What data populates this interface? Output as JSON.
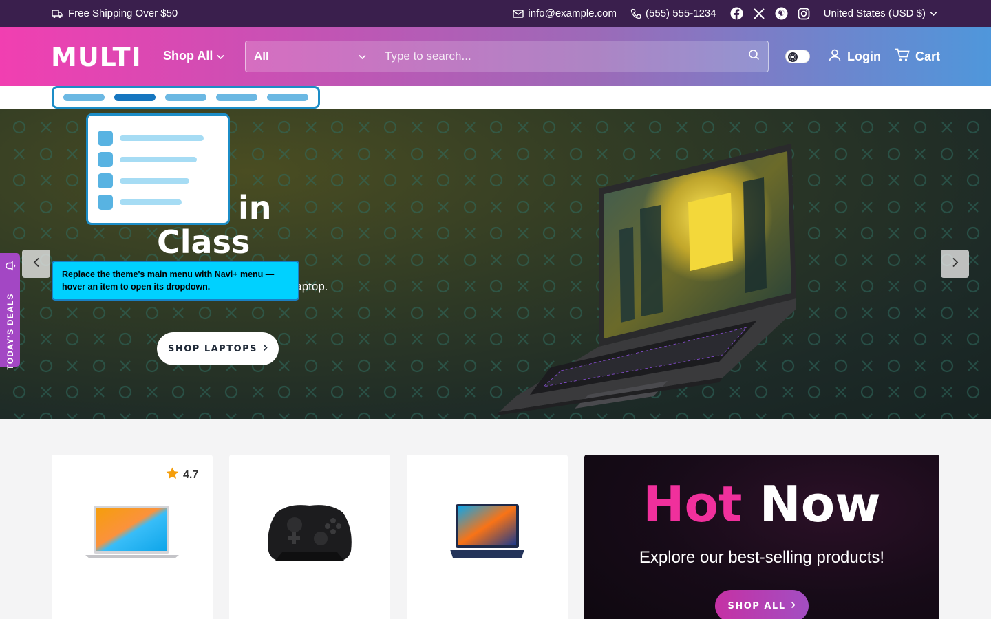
{
  "topbar": {
    "shipping": "Free Shipping Over $50",
    "email": "info@example.com",
    "phone": "(555) 555-1234",
    "social": [
      "facebook-icon",
      "x-icon",
      "pinterest-icon",
      "instagram-icon"
    ],
    "currency": "United States (USD $)"
  },
  "header": {
    "logo": "MULTI",
    "shop_all": "Shop All",
    "search_category": "All",
    "search_placeholder": "Type to search...",
    "login": "Login",
    "cart": "Cart"
  },
  "hero": {
    "title_visible": "in Class",
    "subtitle_visible": "with a High-Performance Laptop.",
    "button": "SHOP LAPTOPS"
  },
  "overlay": {
    "tooltip": "Replace the theme's main menu with Navi+ menu — hover an item to open its dropdown."
  },
  "side_tab": {
    "label": "TODAY'S DEALS"
  },
  "products": [
    {
      "rating": "4.7",
      "image": "laptop-silver"
    },
    {
      "image": "game-controller"
    },
    {
      "image": "laptop-blue"
    }
  ],
  "promo": {
    "title_part1": "Hot",
    "title_part2": "Now",
    "subtitle": "Explore our best-selling products!",
    "button": "SHOP ALL"
  },
  "colors": {
    "topbar": "#3a1f4d",
    "header_gradient_start": "#f13fb1",
    "header_gradient_end": "#4f97db",
    "accent_pink": "#f0309c",
    "deals_tab": "#a347c4",
    "tooltip": "#00d1ff"
  }
}
